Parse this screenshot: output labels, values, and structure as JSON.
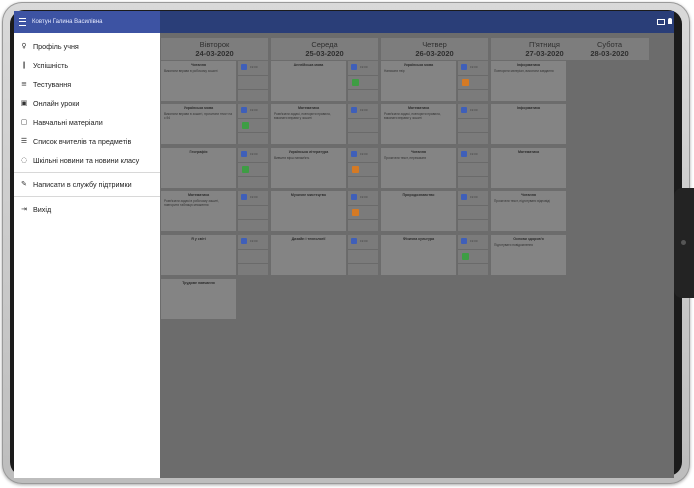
{
  "window": {
    "user_name": "Ковтун Галина Василівна",
    "icons": [
      "menu-icon",
      "mail-icon",
      "bell-icon"
    ]
  },
  "sidebar": {
    "items": [
      {
        "icon": "person-icon",
        "glyph": "♀",
        "label": "Профіль учня"
      },
      {
        "icon": "bar-chart-icon",
        "glyph": "❙",
        "label": "Успішність"
      },
      {
        "icon": "list-icon",
        "glyph": "≡",
        "label": "Тестування"
      },
      {
        "icon": "video-icon",
        "glyph": "▣",
        "label": "Онлайн уроки"
      },
      {
        "icon": "book-icon",
        "glyph": "▢",
        "label": "Навчальні матеріали"
      },
      {
        "icon": "list-check-icon",
        "glyph": "☰",
        "label": "Список вчителів та предметів"
      },
      {
        "icon": "chat-icon",
        "glyph": "◌",
        "label": "Шкільні новини та новини класу"
      },
      {
        "icon": "pencil-icon",
        "glyph": "✎",
        "label": "Написати в службу підтримки"
      },
      {
        "icon": "logout-icon",
        "glyph": "⇥",
        "label": "Вихід"
      }
    ]
  },
  "schedule": {
    "days": [
      {
        "name": "Вівторок",
        "date": "24-03-2020"
      },
      {
        "name": "Середа",
        "date": "25-03-2020"
      },
      {
        "name": "Четвер",
        "date": "26-03-2020"
      },
      {
        "name": "П'ятниця",
        "date": "27-03-2020"
      },
      {
        "name": "Субота",
        "date": "28-03-2020"
      }
    ],
    "columns": [
      {
        "day": "Вівторок",
        "lessons": [
          {
            "title": "Читання",
            "desc": "Виконати вправи в робочому зошиті",
            "hw_time": "19:00",
            "status": "none"
          },
          {
            "title": "Українська мова",
            "desc": "Виконати вправи в зошиті, прочитати текст на с.94",
            "hw_time": "19:00",
            "status": "green"
          },
          {
            "title": "Географія",
            "desc": "",
            "hw_time": "19:00",
            "status": "green"
          },
          {
            "title": "Математика",
            "desc": "Розв'язати задачі в робочому зошиті, повторити таблицю множення",
            "hw_time": "19:00",
            "status": "none"
          },
          {
            "title": "Я у світі",
            "desc": "",
            "hw_time": "19:00",
            "status": "none"
          },
          {
            "title": "Трудове навчання",
            "desc": "",
            "hw_time": "",
            "status": "none"
          }
        ]
      },
      {
        "day": "Середа",
        "lessons": [
          {
            "title": "Англійська мова",
            "desc": "",
            "hw_time": "19:00",
            "status": "green"
          },
          {
            "title": "Математика",
            "desc": "Розв'язати задачі, повторити правила, виконати вправи у зошиті",
            "hw_time": "19:00",
            "status": "none"
          },
          {
            "title": "Українська література",
            "desc": "Вивчити вірш напам'ять",
            "hw_time": "19:00",
            "status": "orange"
          },
          {
            "title": "Музичне мистецтво",
            "desc": "",
            "hw_time": "19:00",
            "status": "orange"
          },
          {
            "title": "Дизайн і технології",
            "desc": "",
            "hw_time": "19:00",
            "status": "none"
          }
        ]
      },
      {
        "day": "Четвер",
        "lessons": [
          {
            "title": "Українська мова",
            "desc": "Написати твір",
            "hw_time": "19:00",
            "status": "orange"
          },
          {
            "title": "Математика",
            "desc": "Розв'язати задачі, повторити правила, виконати вправи у зошиті",
            "hw_time": "19:00",
            "status": "none"
          },
          {
            "title": "Читання",
            "desc": "Прочитати текст, переказати",
            "hw_time": "19:00",
            "status": "none"
          },
          {
            "title": "Природознавство",
            "desc": "",
            "hw_time": "19:00",
            "status": "none"
          },
          {
            "title": "Фізична культура",
            "desc": "",
            "hw_time": "19:00",
            "status": "green"
          }
        ]
      },
      {
        "day": "П'ятниця",
        "lessons": [
          {
            "title": "Інформатика",
            "desc": "Повторити матеріал, виконати завдання",
            "hw_time": "",
            "status": "none"
          },
          {
            "title": "Інформатика",
            "desc": "",
            "hw_time": "",
            "status": "none"
          },
          {
            "title": "Математика",
            "desc": "",
            "hw_time": "",
            "status": "none"
          },
          {
            "title": "Читання",
            "desc": "Прочитати текст, підготувати відповіді",
            "hw_time": "",
            "status": "none"
          },
          {
            "title": "Основи здоров'я",
            "desc": "Підготувати повідомлення",
            "hw_time": "",
            "status": "none"
          }
        ]
      },
      {
        "day": "Субота",
        "lessons": []
      }
    ]
  }
}
